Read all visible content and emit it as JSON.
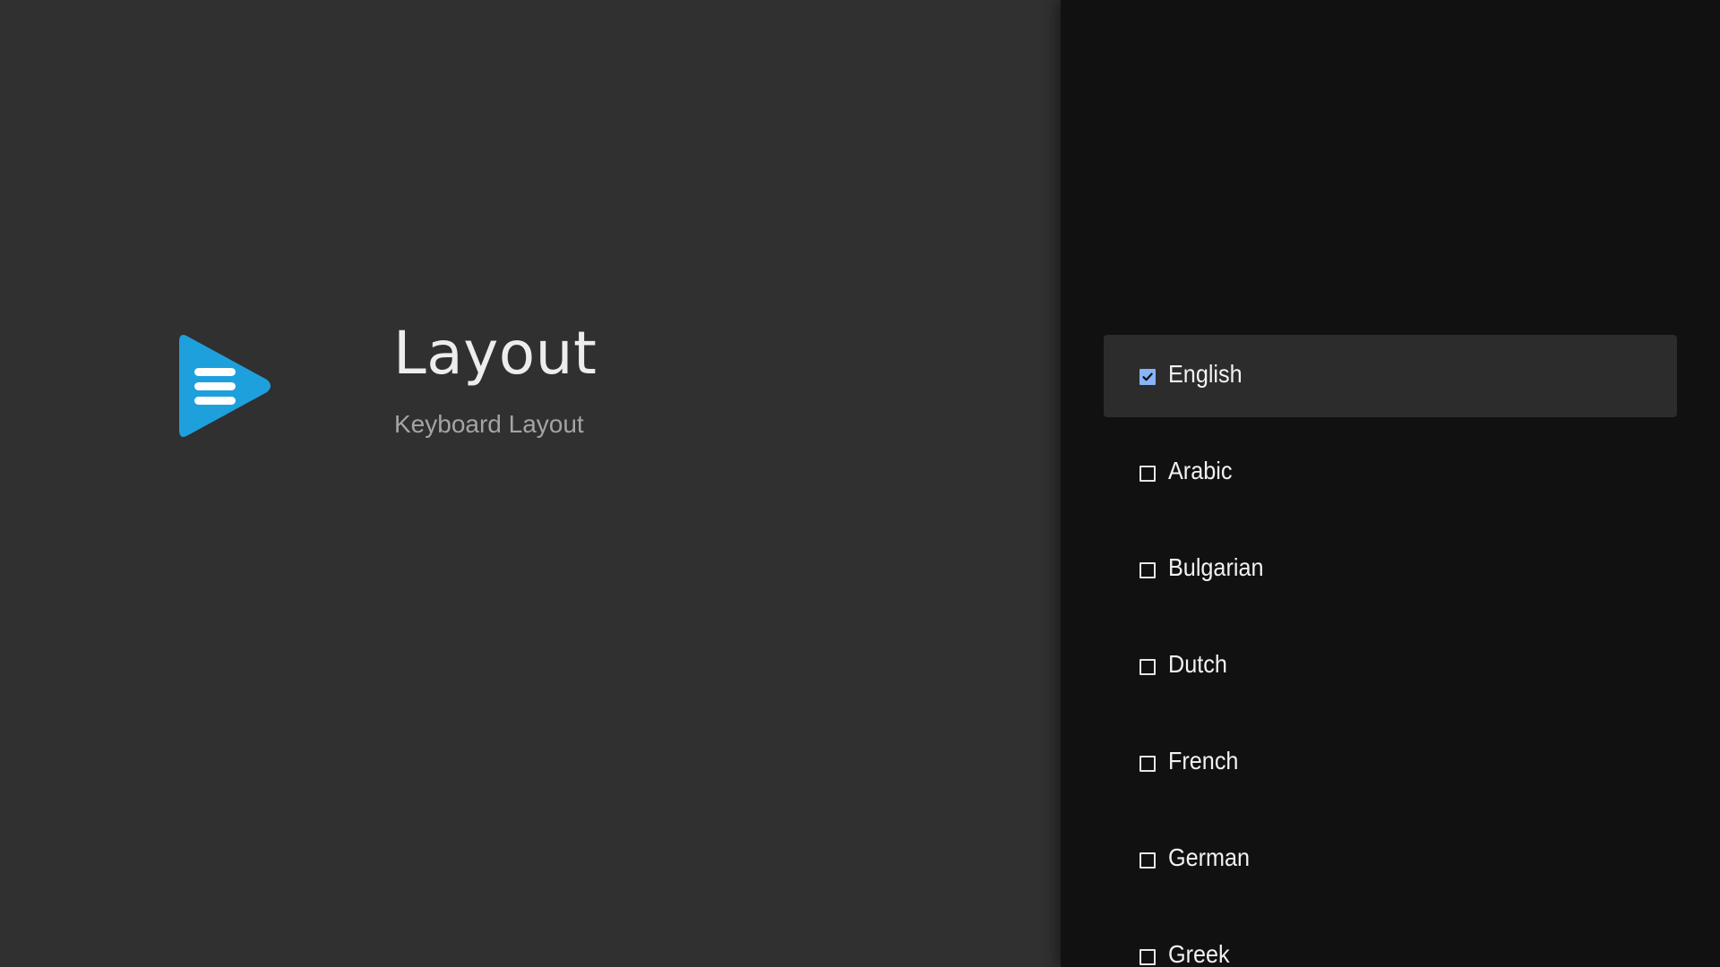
{
  "header": {
    "title": "Layout",
    "subtitle": "Keyboard Layout",
    "icon": "keyboard-play-icon",
    "accent_color": "#1ea0dc"
  },
  "layout_list": {
    "items": [
      {
        "label": "English",
        "checked": true,
        "focused": true
      },
      {
        "label": "Arabic",
        "checked": false,
        "focused": false
      },
      {
        "label": "Bulgarian",
        "checked": false,
        "focused": false
      },
      {
        "label": "Dutch",
        "checked": false,
        "focused": false
      },
      {
        "label": "French",
        "checked": false,
        "focused": false
      },
      {
        "label": "German",
        "checked": false,
        "focused": false
      },
      {
        "label": "Greek",
        "checked": false,
        "focused": false
      }
    ],
    "checkbox_color": "#8ab4f8"
  }
}
